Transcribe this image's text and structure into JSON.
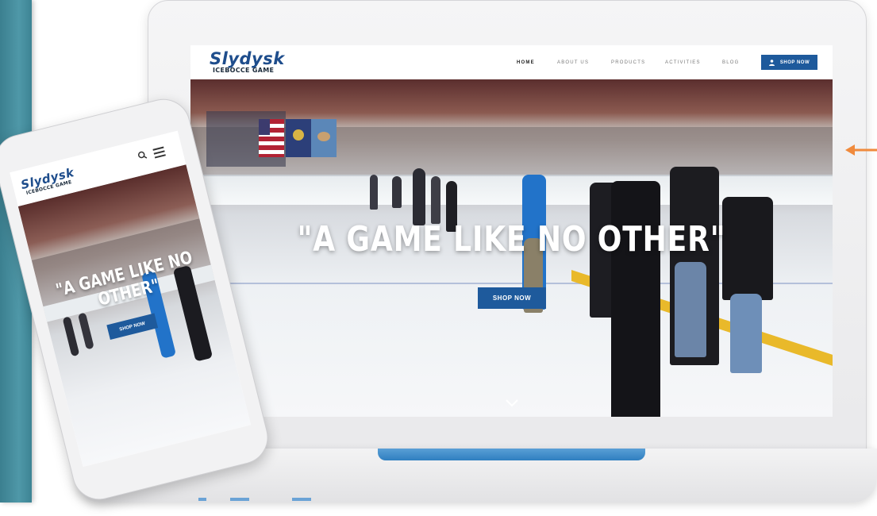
{
  "site": {
    "brand": "Slydysk",
    "tagline": "ICEBOCCE GAME",
    "nav": [
      {
        "label": "HOME",
        "active": true
      },
      {
        "label": "ABOUT US"
      },
      {
        "label": "PRODUCTS"
      },
      {
        "label": "ACTIVITIES"
      },
      {
        "label": "BLOG"
      }
    ],
    "header_button": "SHOP NOW",
    "hero_title": "\"A GAME LIKE NO OTHER\"",
    "hero_button": "SHOP NOW",
    "scroll_icon": "chevron-down-icon"
  },
  "mobile": {
    "brand": "Slydysk",
    "tagline": "ICEBOCCE GAME",
    "hero_title_line1": "\"A GAME LIKE NO",
    "hero_title_line2": "OTHER\"",
    "hero_button": "SHOP NOW",
    "icons": [
      "search-icon",
      "hamburger-menu-icon"
    ]
  },
  "colors": {
    "brand_blue": "#1e5a9c",
    "teal_band": "#4f98a8",
    "accent_orange": "#f08a3c"
  }
}
